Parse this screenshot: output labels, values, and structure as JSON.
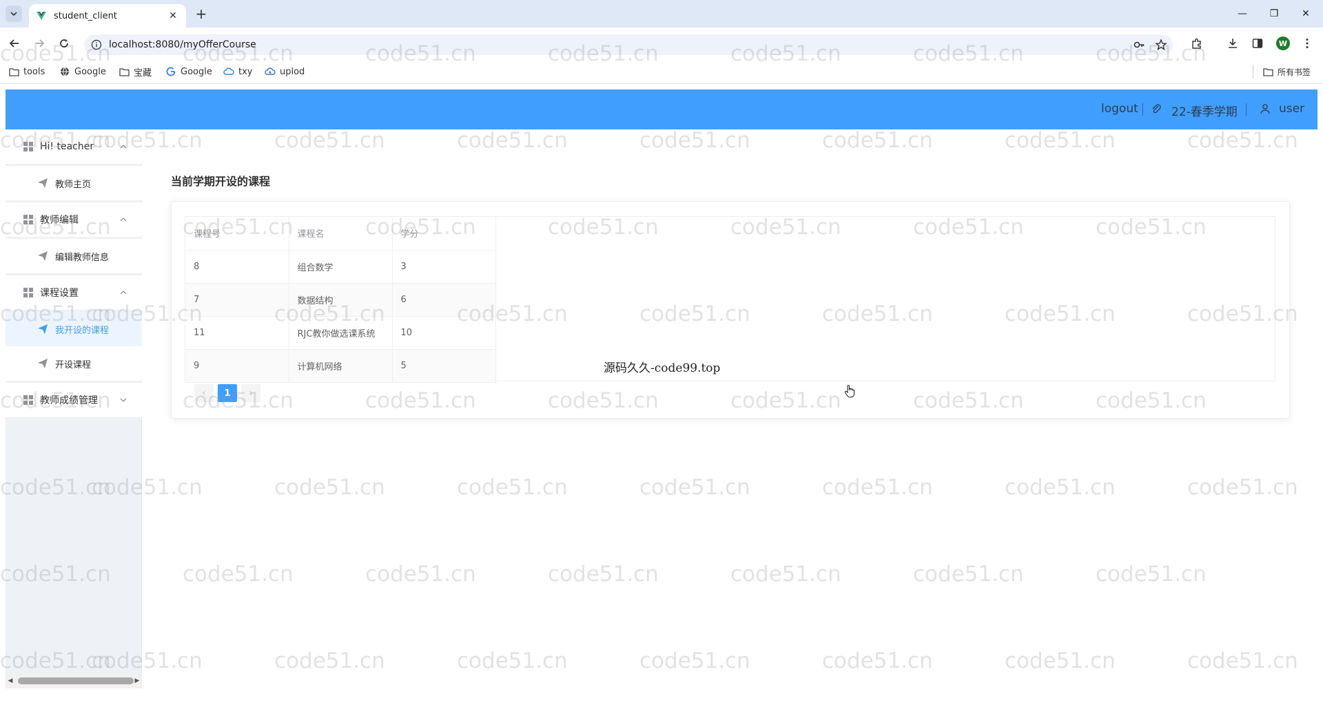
{
  "browser": {
    "tab_title": "student_client",
    "url": "localhost:8080/myOfferCourse",
    "profile_initial": "W",
    "bookmarks": [
      "tools",
      "Google",
      "宝藏",
      "Google",
      "txy",
      "uplod"
    ],
    "all_bookmarks": "所有书签"
  },
  "header": {
    "logout": "logout",
    "term": "22-春季学期",
    "user": "user"
  },
  "sidebar": {
    "groups": [
      {
        "label": "Hi! teacher",
        "items": [
          "教师主页"
        ]
      },
      {
        "label": "教师编辑",
        "items": [
          "编辑教师信息"
        ]
      },
      {
        "label": "课程设置",
        "items": [
          "我开设的课程",
          "开设课程"
        ]
      },
      {
        "label": "教师成绩管理",
        "items": []
      }
    ],
    "active_item": "我开设的课程"
  },
  "main": {
    "title": "当前学期开设的课程",
    "table": {
      "columns": [
        "课程号",
        "课程名",
        "学分"
      ],
      "rows": [
        [
          "8",
          "组合数学",
          "3"
        ],
        [
          "7",
          "数据结构",
          "6"
        ],
        [
          "11",
          "RJC教你做选课系统",
          "10"
        ],
        [
          "9",
          "计算机网络",
          "5"
        ]
      ]
    },
    "pagination": {
      "current_page": "1"
    },
    "overlay_text": "源码久久-code99.top"
  },
  "watermark": "code51.cn",
  "colors": {
    "accent": "#409eff",
    "sidebar_bg": "#eef1f6",
    "active_bg": "#ecf5ff"
  }
}
